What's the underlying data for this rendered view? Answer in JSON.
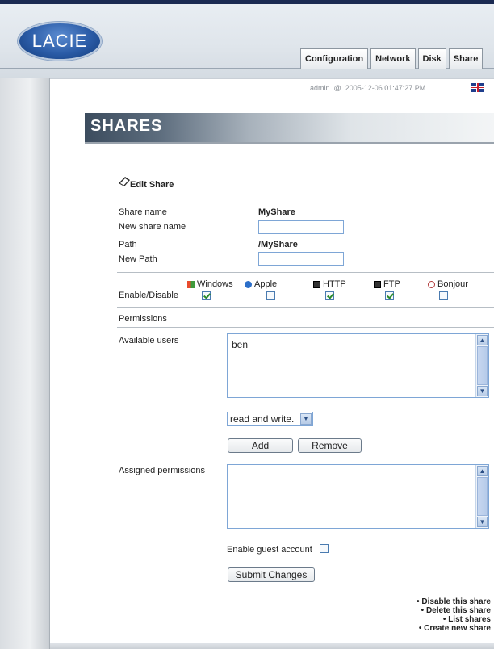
{
  "brand": {
    "logo_text": "LACIE"
  },
  "tabs": [
    "Configuration",
    "Network",
    "Disk",
    "Share"
  ],
  "status": {
    "user": "admin",
    "at": "@",
    "datetime": "2005-12-06 01:47:27 PM"
  },
  "page": {
    "banner_title": "SHARES"
  },
  "edit_share": {
    "title": "Edit Share",
    "share_name_label": "Share name",
    "share_name_value": "MyShare",
    "new_share_name_label": "New share name",
    "new_share_name_value": "",
    "path_label": "Path",
    "path_value": "/MyShare",
    "new_path_label": "New Path",
    "new_path_value": ""
  },
  "services": {
    "label": "Enable/Disable",
    "items": [
      {
        "name": "Windows",
        "enabled": true
      },
      {
        "name": "Apple",
        "enabled": false
      },
      {
        "name": "HTTP",
        "enabled": true
      },
      {
        "name": "FTP",
        "enabled": true
      },
      {
        "name": "Bonjour",
        "enabled": false
      }
    ]
  },
  "permissions": {
    "section_label": "Permissions",
    "available_users_label": "Available users",
    "available_users": [
      "ben"
    ],
    "access_select_value": "read and write.",
    "add_label": "Add",
    "remove_label": "Remove",
    "assigned_label": "Assigned permissions",
    "assigned": [],
    "guest_label": "Enable guest account",
    "guest_enabled": false,
    "submit_label": "Submit Changes"
  },
  "footer_links": [
    "Disable this share",
    "Delete this share",
    "List shares",
    "Create new share"
  ],
  "colors": {
    "field_border": "#7ea6d6",
    "check_mark": "#2a8a2a",
    "banner_dark": "#3c4c5e"
  }
}
